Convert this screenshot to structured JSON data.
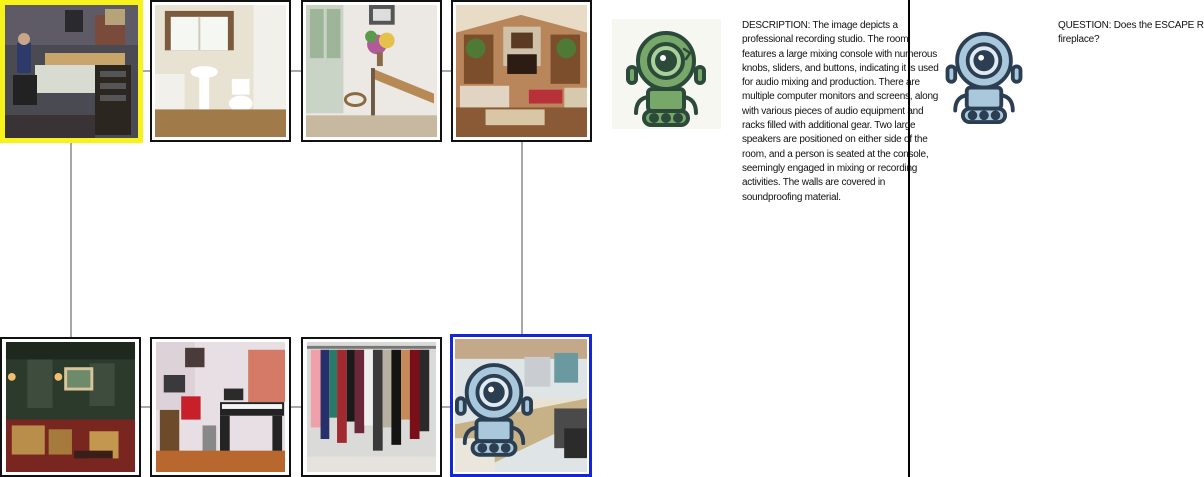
{
  "scenes": [
    {
      "name": "recording studio",
      "state": "start"
    },
    {
      "name": "bathroom"
    },
    {
      "name": "hallway with flowers"
    },
    {
      "name": "living room with fireplace"
    },
    {
      "name": "home theater"
    },
    {
      "name": "music room"
    },
    {
      "name": "closet"
    },
    {
      "name": "office",
      "state": "current"
    }
  ],
  "agents": [
    {
      "icon": "robot-icon",
      "color": "#77a86a"
    },
    {
      "icon": "robot-icon",
      "color": "#a9c8dc"
    }
  ],
  "description": "DESCRIPTION: The image depicts a professional recording studio. The room features a large mixing console with numerous knobs, sliders, and buttons, indicating it is used for audio mixing and production. There are multiple computer monitors and screens, along with various pieces of audio equipment and racks filled with additional gear. Two large speakers are positioned on either side of the room, and a person is seated at the console, seemingly engaged in mixing or recording activities. The walls are covered in soundproofing material.",
  "question": {
    "line1": "QUESTION: Does the ESCAPE RO",
    "line2": "fireplace?"
  },
  "colors": {
    "start_highlight": "#f7f21a",
    "current_highlight": "#1426d6",
    "connector": "#8a8a8a"
  }
}
